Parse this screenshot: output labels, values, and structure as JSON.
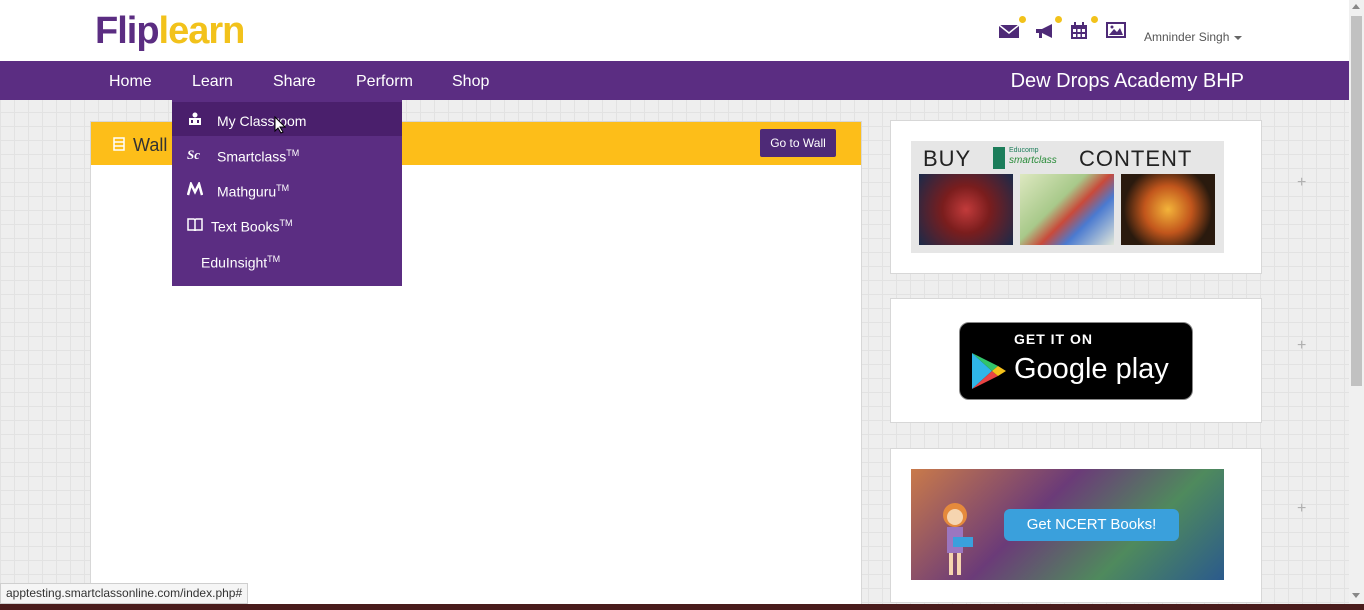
{
  "header": {
    "logo_part1": "Flip",
    "logo_part2": "learn",
    "icons": [
      "mail-icon",
      "megaphone-icon",
      "calendar-icon",
      "image-icon"
    ],
    "user_name": "Amninder Singh"
  },
  "nav": {
    "items": [
      "Home",
      "Learn",
      "Share",
      "Perform",
      "Shop"
    ],
    "school_name": "Dew Drops Academy BHP"
  },
  "dropdown": {
    "items": [
      {
        "label": "My Classroom",
        "tm": "",
        "icon": "classroom-icon",
        "active": true
      },
      {
        "label": "Smartclass",
        "tm": "TM",
        "icon": "smartclass-icon"
      },
      {
        "label": "Mathguru",
        "tm": "TM",
        "icon": "mathguru-icon"
      },
      {
        "label": "Text Books",
        "tm": "TM",
        "icon": "book-icon"
      },
      {
        "label": "EduInsight",
        "tm": "TM",
        "icon": ""
      }
    ]
  },
  "wall": {
    "title": "Wall",
    "button": "Go to Wall"
  },
  "sidebar": {
    "buy_left": "BUY",
    "buy_right": "CONTENT",
    "buy_brand_top": "Educomp",
    "buy_brand": "smartclass",
    "gp_top": "GET IT ON",
    "gp_store": "Google play",
    "ncert_button": "Get NCERT Books!"
  },
  "status_url": "apptesting.smartclassonline.com/index.php#",
  "colors": {
    "brand_purple": "#5b2d82",
    "brand_yellow": "#fdbe19",
    "button_purple": "#4e2a77"
  }
}
